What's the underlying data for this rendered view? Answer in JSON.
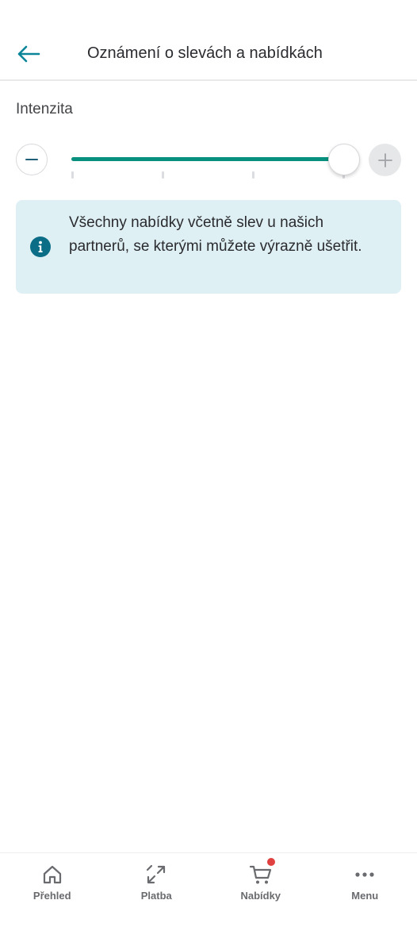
{
  "header": {
    "title": "Oznámení o slevách a nabídkách",
    "back_icon": "arrow-left-icon"
  },
  "intensity": {
    "label": "Intenzita",
    "steps": 4,
    "value_step": 4,
    "min_icon": "minus-icon",
    "max_icon": "plus-icon"
  },
  "info": {
    "icon": "info-icon",
    "text": "Všechny nabídky včetně slev u našich partnerů, se kterými můžete výrazně ušetřit."
  },
  "nav": {
    "items": [
      {
        "label": "Přehled",
        "icon": "home-icon"
      },
      {
        "label": "Platba",
        "icon": "transfer-arrows-icon"
      },
      {
        "label": "Nabídky",
        "icon": "cart-icon"
      },
      {
        "label": "Menu",
        "icon": "more-dots-icon"
      }
    ]
  },
  "colors": {
    "accent": "#06907d",
    "info_bg": "#dff0f4",
    "info_icon": "#0b6e86",
    "badge": "#e0403f",
    "back_arrow": "#0a8597"
  }
}
